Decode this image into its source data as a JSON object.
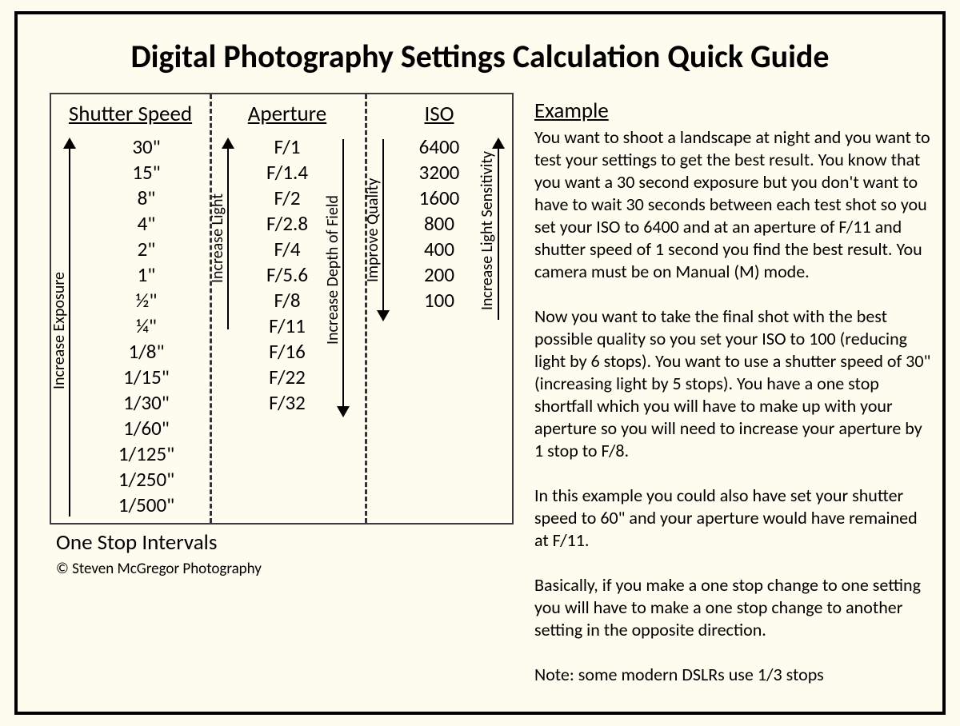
{
  "title": "Digital Photography Settings Calculation Quick Guide",
  "columns": {
    "shutter": {
      "header": "Shutter Speed",
      "values": [
        "30\"",
        "15\"",
        "8\"",
        "4\"",
        "2\"",
        "1\"",
        "½\"",
        "¼\"",
        "1/8\"",
        "1/15\"",
        "1/30\"",
        "1/60\"",
        "1/125\"",
        "1/250\"",
        "1/500\""
      ],
      "arrow_left_label": "Increase Exposure"
    },
    "aperture": {
      "header": "Aperture",
      "values": [
        "F/1",
        "F/1.4",
        "F/2",
        "F/2.8",
        "F/4",
        "F/5.6",
        "F/8",
        "F/11",
        "F/16",
        "F/22",
        "F/32"
      ],
      "arrow_left_label": "Increase Light",
      "arrow_right_label": "Increase Depth of Field"
    },
    "iso": {
      "header": "ISO",
      "values": [
        "6400",
        "3200",
        "1600",
        "800",
        "400",
        "200",
        "100"
      ],
      "arrow_left_label": "Improve Quality",
      "arrow_right_label": "Increase Light Sensitivity"
    }
  },
  "one_stop_label": "One Stop Intervals",
  "copyright": "© Steven McGregor Photography",
  "example": {
    "heading": "Example",
    "p1": "You want to shoot a landscape at night and you want to test your settings to get the best result. You know that you want a 30 second exposure but you don't want to have to wait 30 seconds between each test shot so you set your ISO to 6400 and at an aperture of F/11 and shutter speed of 1 second you find the best result. You camera must be on Manual (M) mode.",
    "p2": "Now you want to take the final shot with the best possible quality so you set your ISO to 100 (reducing light by 6 stops). You want to use a shutter speed of 30\" (increasing light by 5 stops). You have a one stop shortfall which you will have to make up with your aperture so you will need to increase your aperture by 1 stop to F/8.",
    "p3": "In this example you could also have set your shutter speed to 60\" and your aperture would have remained at F/11.",
    "p4": "Basically, if you make a one stop change to one setting you will have to make a one stop change to another setting in the opposite direction.",
    "p5": "Note: some modern DSLRs use 1/3 stops"
  },
  "chart_data": {
    "type": "table",
    "title": "Digital Photography Settings — One Stop Intervals",
    "columns": [
      "Shutter Speed",
      "Aperture",
      "ISO"
    ],
    "rows": [
      [
        "30\"",
        "F/1",
        "6400"
      ],
      [
        "15\"",
        "F/1.4",
        "3200"
      ],
      [
        "8\"",
        "F/2",
        "1600"
      ],
      [
        "4\"",
        "F/2.8",
        "800"
      ],
      [
        "2\"",
        "F/4",
        "400"
      ],
      [
        "1\"",
        "F/5.6",
        "200"
      ],
      [
        "½\"",
        "F/8",
        "100"
      ],
      [
        "¼\"",
        "F/11",
        ""
      ],
      [
        "1/8\"",
        "F/16",
        ""
      ],
      [
        "1/15\"",
        "F/22",
        ""
      ],
      [
        "1/30\"",
        "F/32",
        ""
      ],
      [
        "1/60\"",
        "",
        ""
      ],
      [
        "1/125\"",
        "",
        ""
      ],
      [
        "1/250\"",
        "",
        ""
      ],
      [
        "1/500\"",
        "",
        ""
      ]
    ],
    "arrows": {
      "shutter_up": "Increase Exposure",
      "aperture_up": "Increase Light",
      "aperture_down": "Increase Depth of Field",
      "iso_down": "Improve Quality",
      "iso_up": "Increase Light Sensitivity"
    }
  }
}
